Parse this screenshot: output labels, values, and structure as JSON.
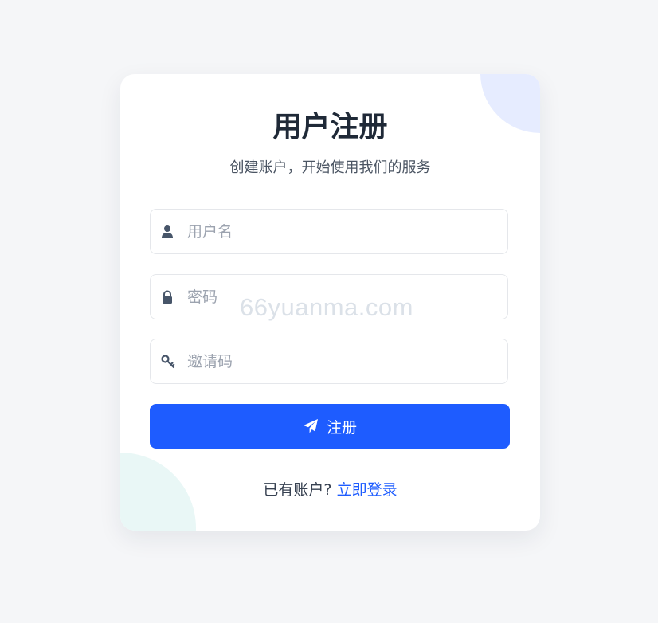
{
  "header": {
    "title": "用户注册",
    "subtitle": "创建账户，开始使用我们的服务"
  },
  "form": {
    "username_placeholder": "用户名",
    "password_placeholder": "密码",
    "invite_placeholder": "邀请码",
    "submit_label": "注册"
  },
  "footer": {
    "prompt": "已有账户?",
    "login_link": "立即登录"
  },
  "watermark": "66yuanma.com",
  "icons": {
    "username": "user-icon",
    "password": "lock-icon",
    "invite": "key-icon",
    "submit": "paper-plane-icon"
  },
  "colors": {
    "accent": "#1e5cff",
    "title": "#1f2937",
    "background": "#f5f6f8",
    "deco_top": "#e6ecff",
    "deco_bottom": "#e9f7f6"
  }
}
